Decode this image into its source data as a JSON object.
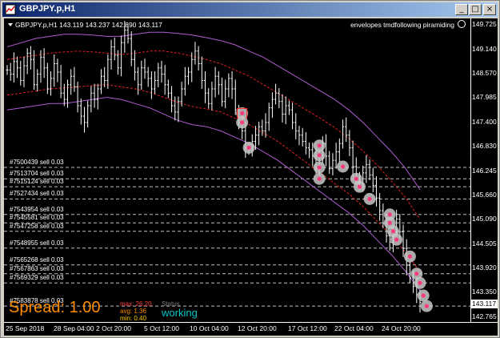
{
  "window": {
    "title": "GBPJPY.p,H1",
    "buttons": {
      "minimize": "_",
      "maximize": "□",
      "close": "×"
    }
  },
  "header": {
    "symbol": "GBPJPY.p,H1",
    "ohlc": "143.119 143.237 142.890 143.117",
    "indicator": "envelopes tmdfollowing piramiding"
  },
  "price_axis": {
    "ticks": [
      "149.725",
      "149.140",
      "148.570",
      "147.985",
      "147.400",
      "146.830",
      "146.245",
      "145.660",
      "145.090",
      "144.505",
      "143.920",
      "143.350",
      "142.765"
    ],
    "current_price": "143.117"
  },
  "time_axis": {
    "labels": [
      "25 Sep 2018",
      "28 Sep 04:00",
      "2 Oct 20:00",
      "5 Oct 12:00",
      "10 Oct 04:00",
      "12 Oct 20:00",
      "17 Oct 12:00",
      "22 Oct 04:00",
      "24 Oct 20:00"
    ]
  },
  "orders": [
    "#7500439 sell 0.03",
    "#7513704 sell 0.03",
    "#7515124 sell 0.03",
    "#7527434 sell 0.03",
    "#7543954 sell 0.03",
    "#7545581 sell 0.03",
    "#7547258 sell 0.03",
    "#7548955 sell 0.03",
    "#7565268 sell 0.03",
    "#7567863 sell 0.03",
    "#7569329 sell 0.03",
    "#7583878 sell 0.03"
  ],
  "overlay": {
    "spread_label": "Spread: 1.00",
    "max": "max: 26.20",
    "avg": "avg: 1.36",
    "min": "min: 0.40",
    "status_label": "Status",
    "status_value": "working"
  },
  "colors": {
    "background": "#000000",
    "envelope": "#b05cd0",
    "inner_band": "#e02020",
    "order_line": "#c0c0c0",
    "marker": "#ff3a7a",
    "spread": "#ff8c00",
    "status": "#00c8c8"
  },
  "chart_data": {
    "type": "line",
    "ylim": [
      142.765,
      149.725
    ],
    "close": [
      148.65,
      148.55,
      148.85,
      148.7,
      148.4,
      148.75,
      149.05,
      148.9,
      148.3,
      148.55,
      148.95,
      148.7,
      148.2,
      148.45,
      148.8,
      148.6,
      148.1,
      147.95,
      148.3,
      148.5,
      148.25,
      147.8,
      147.55,
      147.4,
      147.8,
      148.1,
      147.95,
      148.2,
      148.5,
      148.4,
      148.9,
      149.2,
      149.0,
      148.7,
      149.3,
      149.6,
      149.4,
      148.9,
      148.6,
      148.3,
      148.7,
      148.6,
      148.45,
      148.2,
      148.4,
      148.7,
      148.55,
      148.3,
      148.1,
      147.8,
      147.65,
      147.9,
      148.2,
      148.5,
      148.6,
      148.9,
      149.1,
      148.8,
      148.4,
      148.1,
      147.85,
      148.2,
      148.5,
      148.3,
      147.9,
      148.2,
      148.45,
      148.2,
      147.7,
      147.4,
      147.2,
      146.8,
      146.75,
      146.95,
      147.1,
      147.3,
      147.2,
      147.4,
      147.75,
      147.95,
      148.1,
      147.9,
      147.6,
      147.8,
      147.7,
      147.4,
      147.2,
      147.1,
      146.95,
      146.8,
      146.75,
      146.6,
      146.3,
      146.6,
      146.9,
      146.6,
      146.3,
      146.5,
      146.7,
      146.9,
      147.3,
      147.1,
      146.8,
      146.35,
      146.1,
      145.95,
      146.2,
      146.4,
      146.15,
      145.9,
      145.6,
      145.3,
      145.0,
      144.7,
      144.55,
      144.8,
      145.1,
      144.8,
      144.4,
      144.0,
      143.7,
      143.5,
      143.3,
      143.117
    ],
    "envelope_upper": [
      149.2,
      149.3,
      149.4,
      149.45,
      149.5,
      149.5,
      149.48,
      149.45,
      149.45,
      149.5,
      149.55,
      149.55,
      149.52,
      149.48,
      149.42,
      149.35,
      149.25,
      149.1,
      148.95,
      148.75,
      148.55,
      148.35,
      148.15,
      147.95,
      147.7,
      147.4,
      147.05,
      146.7,
      146.3,
      145.8
    ],
    "envelope_lower": [
      147.7,
      147.75,
      147.8,
      147.85,
      147.85,
      147.9,
      147.95,
      148.0,
      147.95,
      147.85,
      147.75,
      147.6,
      147.45,
      147.35,
      147.3,
      147.2,
      147.05,
      146.9,
      146.7,
      146.5,
      146.25,
      146.0,
      145.75,
      145.5,
      145.25,
      144.95,
      144.6,
      144.25,
      143.85,
      143.4
    ],
    "inner_upper": [
      148.9,
      148.95,
      149.0,
      149.05,
      149.08,
      149.1,
      149.08,
      149.05,
      149.02,
      149.05,
      149.1,
      149.1,
      149.05,
      148.98,
      148.9,
      148.8,
      148.65,
      148.5,
      148.3,
      148.1,
      147.9,
      147.7,
      147.5,
      147.28,
      147.02,
      146.72,
      146.38,
      146.0,
      145.6,
      145.1
    ],
    "inner_lower": [
      148.05,
      148.1,
      148.15,
      148.2,
      148.22,
      148.25,
      148.28,
      148.3,
      148.25,
      148.2,
      148.12,
      148.0,
      147.88,
      147.78,
      147.72,
      147.65,
      147.5,
      147.35,
      147.15,
      146.95,
      146.7,
      146.45,
      146.2,
      145.95,
      145.7,
      145.4,
      145.05,
      144.7,
      144.3,
      143.85
    ],
    "order_prices": [
      146.33,
      146.06,
      145.87,
      145.58,
      145.21,
      145.01,
      144.81,
      144.41,
      144.01,
      143.8,
      143.58,
      143.03
    ],
    "entries": [
      {
        "bar": 70,
        "price": 147.62,
        "selected": true
      },
      {
        "bar": 70,
        "price": 147.4
      },
      {
        "bar": 72,
        "price": 146.8
      },
      {
        "bar": 93,
        "price": 146.85
      },
      {
        "bar": 93,
        "price": 146.62
      },
      {
        "bar": 93,
        "price": 146.33
      },
      {
        "bar": 93,
        "price": 146.06
      },
      {
        "bar": 100,
        "price": 146.35
      },
      {
        "bar": 104,
        "price": 146.06
      },
      {
        "bar": 105,
        "price": 145.87
      },
      {
        "bar": 108,
        "price": 145.58
      },
      {
        "bar": 114,
        "price": 145.21
      },
      {
        "bar": 114,
        "price": 145.01
      },
      {
        "bar": 115,
        "price": 144.81
      },
      {
        "bar": 116,
        "price": 144.61
      },
      {
        "bar": 120,
        "price": 144.21
      },
      {
        "bar": 122,
        "price": 143.8
      },
      {
        "bar": 123,
        "price": 143.58
      },
      {
        "bar": 124,
        "price": 143.28
      },
      {
        "bar": 125,
        "price": 143.03
      }
    ]
  }
}
